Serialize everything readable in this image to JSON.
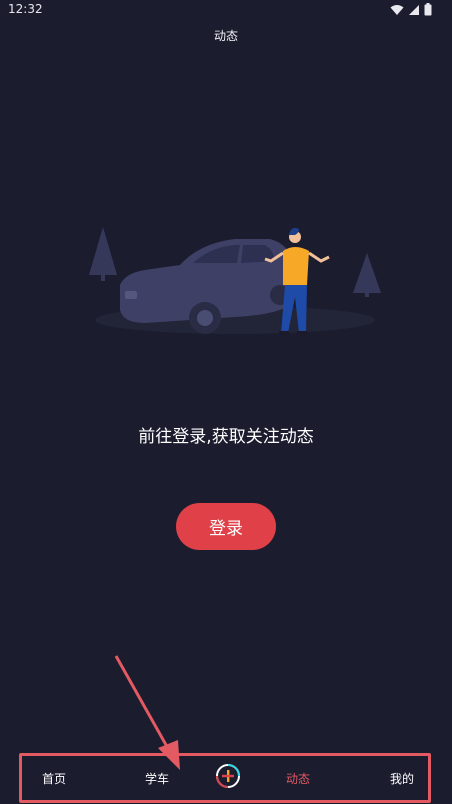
{
  "status_bar": {
    "time": "12:32",
    "icons": [
      "wifi-icon",
      "signal-icon",
      "battery-icon"
    ]
  },
  "header": {
    "title": "动态"
  },
  "main": {
    "prompt": "前往登录,获取关注动态",
    "login_label": "登录",
    "illustration": "car-and-person-illustration"
  },
  "tabbar": {
    "tabs": [
      {
        "label": "首页",
        "active": false
      },
      {
        "label": "学车",
        "active": false
      },
      {
        "label": "",
        "icon": "plus-icon",
        "active": false
      },
      {
        "label": "动态",
        "active": true
      },
      {
        "label": "我的",
        "active": false
      }
    ]
  },
  "colors": {
    "background": "#1b1d2f",
    "accent": "#e04048",
    "active_tab": "#e05a63",
    "annotation": "#e35a62"
  }
}
